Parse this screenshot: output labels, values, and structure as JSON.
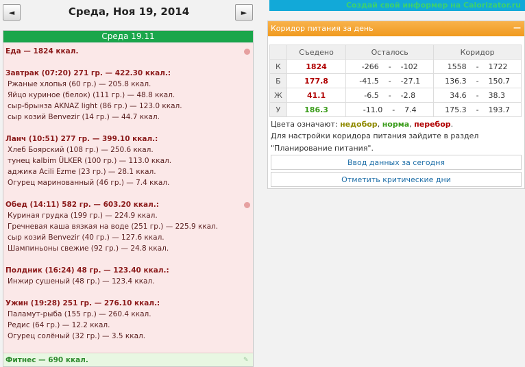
{
  "nav": {
    "prev": "◄",
    "next": "►"
  },
  "date_title": "Среда, Ноя 19, 2014",
  "day_header": "Среда 19.11",
  "food_total": "Еда — 1824 ккал.",
  "meals": [
    {
      "summary": "Завтрак (07:20) 271 гр. — 422.30 ккал.:",
      "items": [
        "Ржаные хлопья (60 гр.) — 205.8 ккал.",
        "Яйцо куриное (белок) (111 гр.) — 48.8 ккал.",
        "сыр-брынза AKNAZ light (86 гр.) — 123.0 ккал.",
        "сыр козий Benvezir (14 гр.) — 44.7 ккал."
      ]
    },
    {
      "summary": "Ланч (10:51) 277 гр. — 399.10 ккал.:",
      "items": [
        "Хлеб Боярский (108 гр.) — 250.6 ккал.",
        "тунец kalbim ÜLKER (100 гр.) — 113.0 ккал.",
        "аджика Acili Ezme (23 гр.) — 28.1 ккал.",
        "Огурец маринованный (46 гр.) — 7.4 ккал."
      ]
    },
    {
      "summary": "Обед (14:11) 582 гр. — 603.20 ккал.:",
      "items": [
        "Куриная грудка (199 гр.) — 224.9 ккал.",
        "Гречневая каша вязкая на воде (251 гр.) — 225.9 ккал.",
        "сыр козий Benvezir (40 гр.) — 127.6 ккал.",
        "Шампиньоны свежие (92 гр.) — 24.8 ккал."
      ]
    },
    {
      "summary": "Полдник (16:24) 48 гр. — 123.40 ккал.:",
      "items": [
        "Инжир сушеный (48 гр.) — 123.4 ккал."
      ]
    },
    {
      "summary": "Ужин (19:28) 251 гр. — 276.10 ккал.:",
      "items": [
        "Паламут-рыба (155 гр.) — 260.4 ккал.",
        "Редис (64 гр.) — 12.2 ккал.",
        "Огурец солёный (32 гр.) — 3.5 ккал."
      ]
    }
  ],
  "fitness": "Фитнес — 690 ккал.",
  "top_bar_text": "Создай свой информер на Calorizator.ru",
  "corridor": {
    "title": "Коридор питания за день",
    "collapse": "—",
    "headers": [
      "Съедено",
      "Осталось",
      "Коридор"
    ],
    "rows": [
      {
        "label": "К",
        "eaten": "1824",
        "eaten_class": "red",
        "left_a": "-266",
        "left_b": "-102",
        "c_a": "1558",
        "c_b": "1722"
      },
      {
        "label": "Б",
        "eaten": "177.8",
        "eaten_class": "red",
        "left_a": "-41.5",
        "left_b": "-27.1",
        "c_a": "136.3",
        "c_b": "150.7"
      },
      {
        "label": "Ж",
        "eaten": "41.1",
        "eaten_class": "red",
        "left_a": "-6.5",
        "left_b": "-2.8",
        "c_a": "34.6",
        "c_b": "38.3"
      },
      {
        "label": "У",
        "eaten": "186.3",
        "eaten_class": "green",
        "left_a": "-11.0",
        "left_b": "7.4",
        "c_a": "175.3",
        "c_b": "193.7"
      }
    ],
    "legend_prefix": "Цвета означают:",
    "legend_under": "недобор",
    "legend_norm": "норма",
    "legend_over": "перебор",
    "info_line1": "Для настройки коридора питания зайдите в раздел",
    "info_line2": "\"Планирование питания\".",
    "enter_data": "Ввод данных за сегодня",
    "critical_days": "Отметить критические дни"
  },
  "colors": {
    "header_green": "#1aa64b",
    "corridor_orange": "#f3a233",
    "over_red": "#b00000",
    "norm_green": "#3a9c1a",
    "under_olive": "#8f8a00"
  }
}
